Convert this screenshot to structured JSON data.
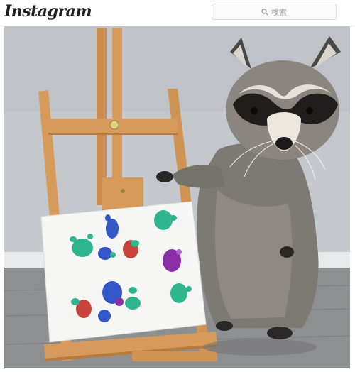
{
  "header": {
    "logo_text": "Instagram",
    "search_placeholder": "検索",
    "search_icon": "search-icon"
  },
  "post": {
    "image_subject": "photo",
    "colors": {
      "wall": "#c4c8cd",
      "floor": "#8e8f91",
      "easel_wood": "#d69b5a",
      "paw_green": "#2fb58e",
      "paw_blue": "#3457c7",
      "paw_red": "#c9433d",
      "paw_purple": "#8a2fa8"
    }
  }
}
